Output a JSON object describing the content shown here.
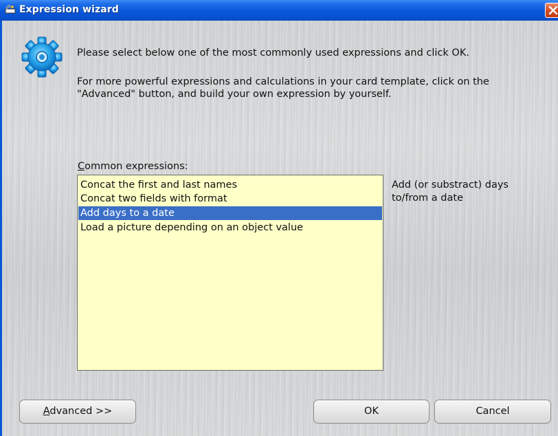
{
  "window": {
    "title": "Expression wizard",
    "icons": {
      "app": "wizard-icon",
      "close": "close-icon",
      "gear": "gear-icon"
    }
  },
  "intro": {
    "line1": "Please select below one of the most commonly used expressions and click OK.",
    "line2": "For more powerful expressions and calculations in your card template, click on the",
    "line3": "\"Advanced\" button, and build your own expression by yourself."
  },
  "expressions": {
    "label_mnemonic": "C",
    "label_rest": "ommon expressions:",
    "items": [
      {
        "label": "Concat the first and last names",
        "selected": false
      },
      {
        "label": "Concat two fields with format",
        "selected": false
      },
      {
        "label": "Add days to a date",
        "selected": true
      },
      {
        "label": "Load a picture depending on an object value",
        "selected": false
      }
    ],
    "description_line1": "Add (or substract) days",
    "description_line2": "to/from a date"
  },
  "buttons": {
    "advanced_mnemonic": "A",
    "advanced_rest": "dvanced >>",
    "ok": "OK",
    "cancel": "Cancel"
  },
  "colors": {
    "titlebar": "#0a58da",
    "list_background": "#ffffc8",
    "selection": "#3a6fc6",
    "close_button": "#d54a1f"
  }
}
